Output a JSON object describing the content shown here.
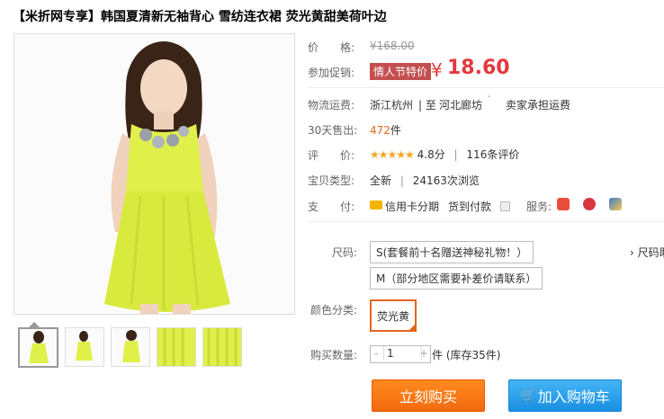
{
  "title": "【米折网专享】韩国夏清新无袖背心 雪纺连衣裙 荧光黄甜美荷叶边",
  "price": {
    "label": "价　　格:",
    "original": "¥168.00"
  },
  "promo": {
    "label": "参加促销:",
    "tag": "情人节特价",
    "yen": "¥",
    "price": "18.60"
  },
  "shipping": {
    "label": "物流运费:",
    "from": "浙江杭州",
    "to_sep": "| 至",
    "to": "河北廊坊",
    "caret": "ˇ",
    "fee": "卖家承担运费"
  },
  "sales": {
    "label": "30天售出:",
    "count": "472",
    "unit": "件"
  },
  "rating": {
    "label": "评　　价:",
    "stars": "★★★★★",
    "score": "4.8分",
    "sep": "|",
    "reviews": "116条评价"
  },
  "condition": {
    "label": "宝贝类型:",
    "type": "全新",
    "sep": "|",
    "views": "24163次浏览"
  },
  "payment": {
    "label": "支　　付:",
    "credit": "信用卡分期",
    "cod": "货到付款",
    "service_label": "服务:"
  },
  "size": {
    "label": "尺码:",
    "options": [
      "S(套餐前十名赠送神秘礼物！）",
      "M（部分地区需要补差价请联系）"
    ],
    "side_link": "› 尺码助"
  },
  "color": {
    "label": "颜色分类:",
    "selected": "荧光黄"
  },
  "quantity": {
    "label": "购买数量:",
    "minus": "-",
    "value": "1",
    "plus": "+",
    "stock": "件 (库存35件)"
  },
  "actions": {
    "buy": "立刻购买",
    "cart": "加入购物车",
    "cart_icon": "🛒"
  },
  "colors": {
    "accent": "#e4393c",
    "orange": "#e4661c",
    "dress": "#e0f04a"
  }
}
